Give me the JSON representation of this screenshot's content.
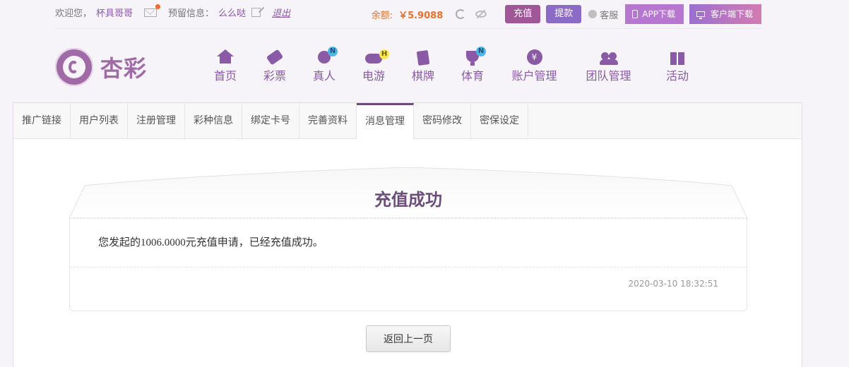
{
  "topbar": {
    "welcome": "欢迎您，",
    "username": "杯具哥哥",
    "reserve_label": "预留信息：",
    "reserve_value": "么么哒",
    "logout": "退出",
    "balance_label": "余额:",
    "balance_value": "￥5.9088",
    "recharge": "充值",
    "withdraw": "提款",
    "service": "客服",
    "app_download": "APP下载",
    "client_download": "客户端下载"
  },
  "logo": {
    "text": "杏彩"
  },
  "nav": {
    "items": [
      {
        "label": "首页"
      },
      {
        "label": "彩票"
      },
      {
        "label": "真人",
        "badge": "N"
      },
      {
        "label": "电游",
        "badge": "H"
      },
      {
        "label": "棋牌"
      },
      {
        "label": "体育",
        "badge": "N"
      },
      {
        "label": "账户管理"
      },
      {
        "label": "团队管理"
      },
      {
        "label": "活动"
      }
    ]
  },
  "tabs": {
    "items": [
      {
        "label": "推广链接"
      },
      {
        "label": "用户列表"
      },
      {
        "label": "注册管理"
      },
      {
        "label": "彩种信息"
      },
      {
        "label": "绑定卡号"
      },
      {
        "label": "完善资料"
      },
      {
        "label": "消息管理"
      },
      {
        "label": "密码修改"
      },
      {
        "label": "密保设定"
      }
    ],
    "active": "消息管理"
  },
  "message": {
    "title": "充值成功",
    "body": "您发起的1006.0000元充值申请，已经充值成功。",
    "time": "2020-03-10 18:32:51"
  },
  "actions": {
    "back": "返回上一页"
  },
  "colors": {
    "accent": "#8a5aa6",
    "balance": "#e8712a",
    "title": "#6b4c7a"
  },
  "icons": {
    "mail": "mail-icon",
    "edit": "edit-icon",
    "refresh": "refresh-icon",
    "hide": "eye-off-icon",
    "service": "service-icon",
    "phone": "phone-icon",
    "monitor": "monitor-icon"
  }
}
